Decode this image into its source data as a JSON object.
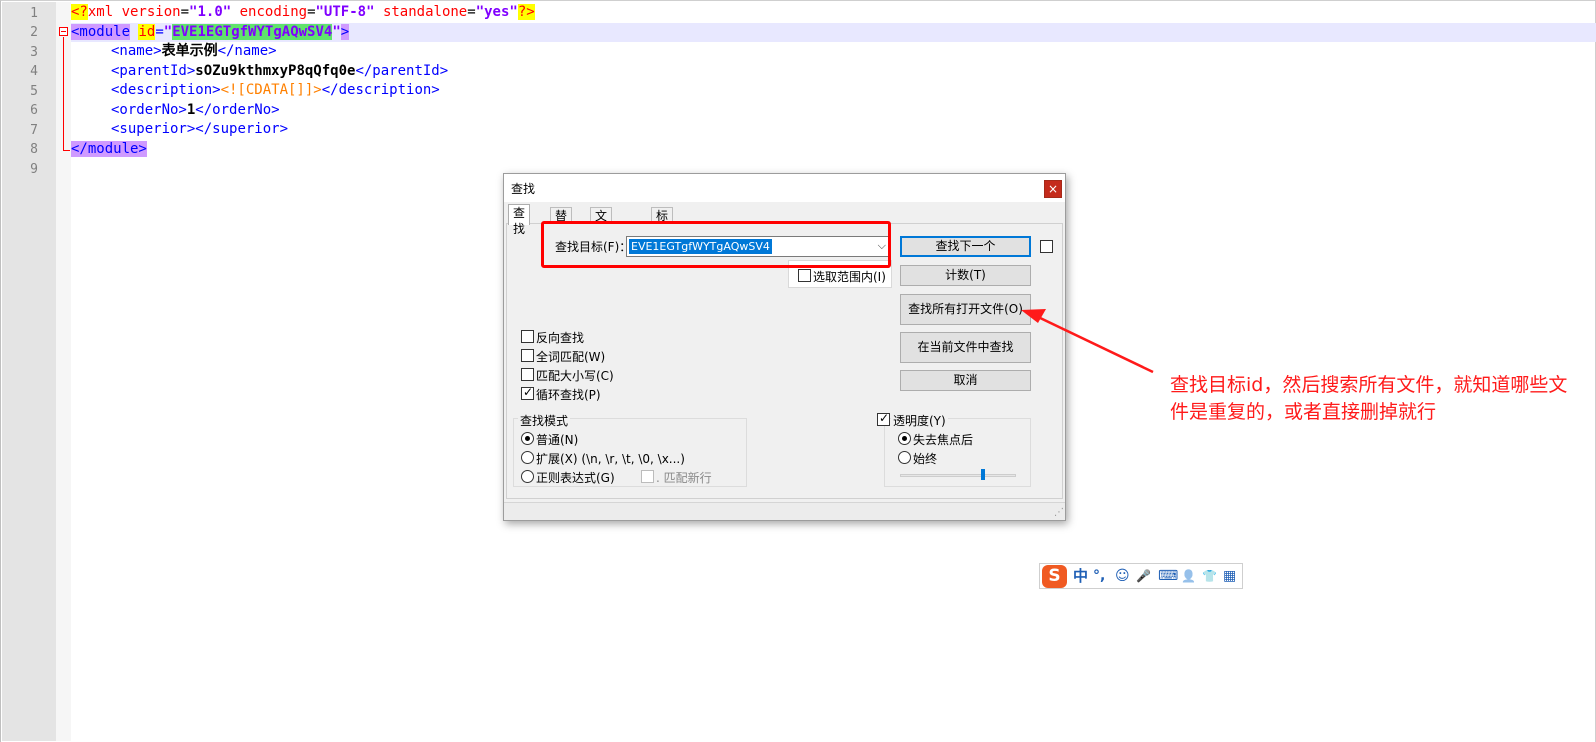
{
  "editor": {
    "line_numbers": [
      "1",
      "2",
      "3",
      "4",
      "5",
      "6",
      "7",
      "8",
      "9"
    ],
    "lines": {
      "l1": {
        "pi_open": "<?",
        "pi_name": "xml ",
        "a1": "version",
        "eq1": "=",
        "v1": "\"1.0\"",
        "sp1": " ",
        "a2": "encoding",
        "eq2": "=",
        "v2": "\"UTF-8\"",
        "sp2": " ",
        "a3": "standalone",
        "eq3": "=",
        "v3": "\"yes\"",
        "pi_close": "?>"
      },
      "l2": {
        "tag_open": "<module",
        "sp": " ",
        "attr": "id",
        "eq": "=",
        "q1": "\"",
        "value": "EVE1EGTgfWYTgAQwSV4",
        "q2": "\"",
        "close": ">"
      },
      "l3": {
        "open": "<name>",
        "text": "表单示例",
        "close": "</name>"
      },
      "l4": {
        "open": "<parentId>",
        "text": "sOZu9kthmxyP8qQfq0e",
        "close": "</parentId>"
      },
      "l5": {
        "open": "<description>",
        "cdata": "<![CDATA[]]>",
        "close": "</description>"
      },
      "l6": {
        "open": "<orderNo>",
        "text": "1",
        "close": "</orderNo>"
      },
      "l7": {
        "open": "<superior>",
        "close": "</superior>"
      },
      "l8": {
        "close": "</module>"
      }
    }
  },
  "find_dialog": {
    "title": "查找",
    "close": "×",
    "tabs": [
      "查找",
      "替换",
      "文件查找",
      "标记"
    ],
    "find_label": "查找目标(F)：",
    "find_value": "EVE1EGTgfWYTgAQwSV4",
    "combo_chevron": "⌵",
    "buttons": {
      "find_next": "查找下一个",
      "count": "计数(T)",
      "find_all_open": "查找所有打开文件(O)",
      "find_in_current": "在当前文件中查找",
      "cancel": "取消"
    },
    "in_selection": "选取范围内(I)",
    "options": [
      {
        "label": "反向查找",
        "checked": false
      },
      {
        "label": "全词匹配(W)",
        "checked": false
      },
      {
        "label": "匹配大小写(C)",
        "checked": false
      },
      {
        "label": "循环查找(P)",
        "checked": true
      }
    ],
    "search_mode": {
      "title": "查找模式",
      "normal": "普通(N)",
      "extended": "扩展(X) (\\n, \\r, \\t, \\0, \\x...)",
      "regex": "正则表达式(G)",
      "match_newline": ". 匹配新行",
      "selected": "normal"
    },
    "transparency": {
      "label": "透明度(Y)",
      "checked": true,
      "on_lose_focus": "失去焦点后",
      "always": "始终",
      "selected": "on_lose_focus",
      "level": 0.71
    },
    "resize_grip": "⋰"
  },
  "annotation": {
    "text": "查找目标id，然后搜索所有文件，就知道哪些文件是重复的，或者直接删掉就行",
    "color": "#ff1a1a"
  },
  "ime_toolbar": {
    "logo": "S",
    "lang": "中",
    "punct": "°,",
    "icons": [
      "smiley-icon",
      "microphone-icon",
      "keyboard-icon",
      "user-icon",
      "shirt-icon",
      "grid-icon"
    ],
    "glyphs": [
      "☺",
      "🎤",
      "⌨",
      "👤",
      "👕",
      "▦"
    ]
  }
}
